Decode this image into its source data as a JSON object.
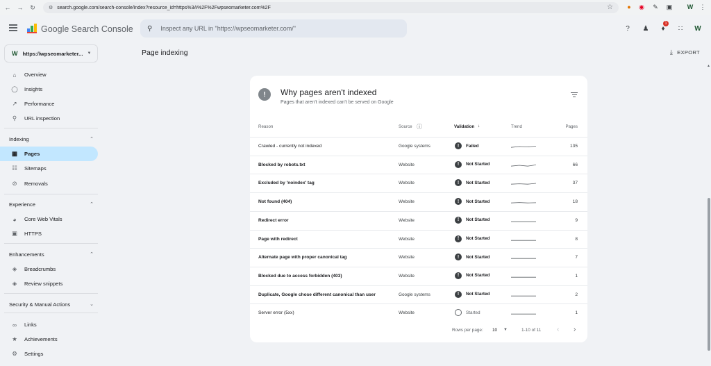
{
  "browser": {
    "url": "search.google.com/search-console/index?resource_id=https%3A%2F%2Fwpseomarketer.com%2F",
    "notification_count": "1"
  },
  "header": {
    "app_title": "Google Search Console",
    "search_placeholder": "Inspect any URL in \"https://wpseomarketer.com/\""
  },
  "sidebar": {
    "property": "https://wpseomarketer...",
    "items": [
      {
        "label": "Overview",
        "icon": "home-icon"
      },
      {
        "label": "Insights",
        "icon": "lightbulb-icon"
      },
      {
        "label": "Performance",
        "icon": "trending-icon"
      },
      {
        "label": "URL inspection",
        "icon": "search-icon"
      }
    ],
    "sections": [
      {
        "title": "Indexing",
        "items": [
          {
            "label": "Pages",
            "icon": "pages-icon",
            "active": true
          },
          {
            "label": "Sitemaps",
            "icon": "sitemap-icon"
          },
          {
            "label": "Removals",
            "icon": "removals-icon"
          }
        ]
      },
      {
        "title": "Experience",
        "items": [
          {
            "label": "Core Web Vitals",
            "icon": "gauge-icon"
          },
          {
            "label": "HTTPS",
            "icon": "lock-icon"
          }
        ]
      },
      {
        "title": "Enhancements",
        "items": [
          {
            "label": "Breadcrumbs",
            "icon": "layers-icon"
          },
          {
            "label": "Review snippets",
            "icon": "layers-icon"
          }
        ]
      },
      {
        "title": "Security & Manual Actions",
        "items": []
      }
    ],
    "bottom_items": [
      {
        "label": "Links",
        "icon": "link-icon"
      },
      {
        "label": "Achievements",
        "icon": "trophy-icon"
      },
      {
        "label": "Settings",
        "icon": "gear-icon"
      }
    ]
  },
  "main": {
    "page_title": "Page indexing",
    "export_label": "EXPORT",
    "card": {
      "title": "Why pages aren't indexed",
      "subtitle": "Pages that aren't indexed can't be served on Google",
      "columns": {
        "reason": "Reason",
        "source": "Source",
        "validation": "Validation",
        "trend": "Trend",
        "pages": "Pages"
      },
      "rows": [
        {
          "reason": "Crawled - currently not indexed",
          "source": "Google systems",
          "validation": "Failed",
          "pages": "135",
          "bold": false,
          "trend": [
            0.3,
            0.5,
            0.4,
            0.6
          ]
        },
        {
          "reason": "Blocked by robots.txt",
          "source": "Website",
          "validation": "Not Started",
          "pages": "66",
          "bold": true,
          "trend": [
            0.3,
            0.5,
            0.3,
            0.6
          ]
        },
        {
          "reason": "Excluded by 'noindex' tag",
          "source": "Website",
          "validation": "Not Started",
          "pages": "37",
          "bold": true,
          "trend": [
            0.3,
            0.4,
            0.3,
            0.5
          ]
        },
        {
          "reason": "Not found (404)",
          "source": "Website",
          "validation": "Not Started",
          "pages": "18",
          "bold": true,
          "trend": [
            0.3,
            0.4,
            0.3,
            0.35
          ]
        },
        {
          "reason": "Redirect error",
          "source": "Website",
          "validation": "Not Started",
          "pages": "9",
          "bold": true,
          "trend": [
            0.3,
            0.3,
            0.3,
            0.3
          ]
        },
        {
          "reason": "Page with redirect",
          "source": "Website",
          "validation": "Not Started",
          "pages": "8",
          "bold": true,
          "trend": [
            0.3,
            0.3,
            0.3,
            0.3
          ]
        },
        {
          "reason": "Alternate page with proper canonical tag",
          "source": "Website",
          "validation": "Not Started",
          "pages": "7",
          "bold": true,
          "trend": [
            0.3,
            0.3,
            0.3,
            0.3
          ]
        },
        {
          "reason": "Blocked due to access forbidden (403)",
          "source": "Website",
          "validation": "Not Started",
          "pages": "1",
          "bold": true,
          "trend": [
            0.3,
            0.3,
            0.3,
            0.3
          ]
        },
        {
          "reason": "Duplicate, Google chose different canonical than user",
          "source": "Google systems",
          "validation": "Not Started",
          "pages": "2",
          "bold": true,
          "trend": [
            0.3,
            0.3,
            0.3,
            0.3
          ]
        },
        {
          "reason": "Server error (5xx)",
          "source": "Website",
          "validation": "Started",
          "pages": "1",
          "bold": false,
          "trend": [
            0.3,
            0.3,
            0.3,
            0.3
          ]
        }
      ],
      "footer": {
        "rows_per_page_label": "Rows per page:",
        "rows_per_page": "10",
        "range": "1-10 of 11"
      }
    }
  }
}
